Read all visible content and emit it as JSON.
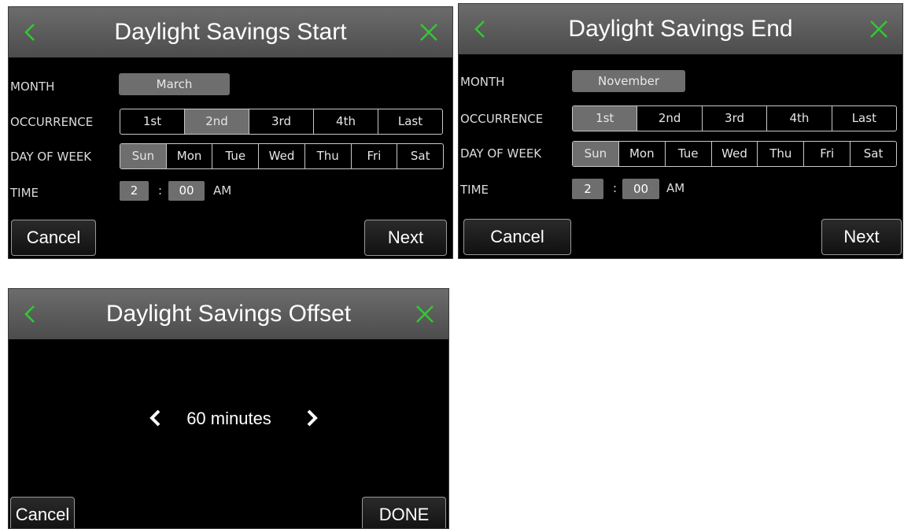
{
  "colors": {
    "accent_green": "#2ecc2e",
    "titlebar": "#5c5c5c",
    "selected": "#6e6e6e"
  },
  "icons": {
    "back": "chevron-left-icon",
    "close": "close-icon",
    "prev": "chevron-left-icon",
    "next": "chevron-right-icon"
  },
  "start": {
    "title": "Daylight Savings Start",
    "month_label": "MONTH",
    "month_value": "March",
    "occurrence_label": "OCCURRENCE",
    "occurrences": [
      "1st",
      "2nd",
      "3rd",
      "4th",
      "Last"
    ],
    "occurrence_selected": "2nd",
    "dow_label": "DAY OF WEEK",
    "days": [
      "Sun",
      "Mon",
      "Tue",
      "Wed",
      "Thu",
      "Fri",
      "Sat"
    ],
    "day_selected": "Sun",
    "time_label": "TIME",
    "hour": "2",
    "sep": ":",
    "minute": "00",
    "ampm": "AM",
    "cancel": "Cancel",
    "next": "Next"
  },
  "end": {
    "title": "Daylight Savings End",
    "month_label": "MONTH",
    "month_value": "November",
    "occurrence_label": "OCCURRENCE",
    "occurrences": [
      "1st",
      "2nd",
      "3rd",
      "4th",
      "Last"
    ],
    "occurrence_selected": "1st",
    "dow_label": "DAY OF WEEK",
    "days": [
      "Sun",
      "Mon",
      "Tue",
      "Wed",
      "Thu",
      "Fri",
      "Sat"
    ],
    "day_selected": "Sun",
    "time_label": "TIME",
    "hour": "2",
    "sep": ":",
    "minute": "00",
    "ampm": "AM",
    "cancel": "Cancel",
    "next": "Next"
  },
  "offset": {
    "title": "Daylight Savings Offset",
    "value": "60 minutes",
    "cancel": "Cancel",
    "done": "DONE"
  }
}
